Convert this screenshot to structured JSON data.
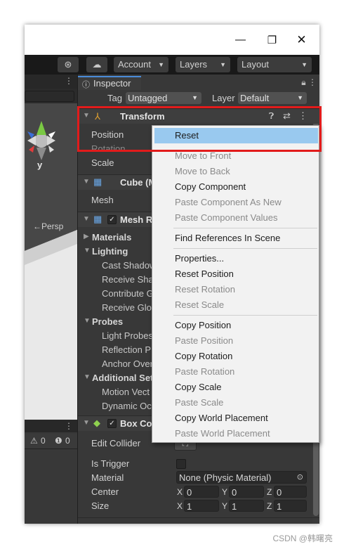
{
  "toolbar": {
    "account_label": "Account",
    "layers_label": "Layers",
    "layout_label": "Layout"
  },
  "scene": {
    "axis_label": "y",
    "persp_label": "←Persp",
    "warning_count": "0",
    "info_count": "0"
  },
  "inspector": {
    "tab_label": "Inspector",
    "tag_label": "Tag",
    "tag_value": "Untagged",
    "layer_label": "Layer",
    "layer_value": "Default",
    "transform": {
      "title": "Transform",
      "position_label": "Position",
      "rotation_label": "Rotation",
      "scale_label": "Scale"
    },
    "cube": {
      "title": "Cube (M",
      "mesh_label": "Mesh"
    },
    "mesh_renderer": {
      "title": "Mesh R",
      "materials_label": "Materials",
      "lighting_label": "Lighting",
      "cast_shadows": "Cast Shadow",
      "receive_shadows": "Receive Sha",
      "contribute_gi": "Contribute G",
      "receive_gi": "Receive Glo",
      "probes_label": "Probes",
      "light_probes": "Light Probes",
      "reflection_probes": "Reflection P",
      "anchor_override": "Anchor Over",
      "additional_settings": "Additional Set",
      "motion_vectors": "Motion Vect",
      "dynamic_occlusion": "Dynamic Oc"
    },
    "box_collider": {
      "title": "Box Col",
      "edit_collider": "Edit Collider",
      "is_trigger": "Is Trigger",
      "material_label": "Material",
      "material_value": "None (Physic Material)",
      "center_label": "Center",
      "size_label": "Size",
      "center": {
        "x": "0",
        "y": "0",
        "z": "0"
      },
      "size": {
        "x": "1",
        "y": "1",
        "z": "1"
      },
      "axis_x": "X",
      "axis_y": "Y",
      "axis_z": "Z"
    }
  },
  "context_menu": {
    "items": [
      {
        "label": "Reset",
        "enabled": true,
        "selected": true
      },
      {
        "label": "Move to Front",
        "enabled": false
      },
      {
        "label": "Move to Back",
        "enabled": false
      },
      {
        "label": "Copy Component",
        "enabled": true
      },
      {
        "label": "Paste Component As New",
        "enabled": false
      },
      {
        "label": "Paste Component Values",
        "enabled": false
      },
      {
        "label": "Find References In Scene",
        "enabled": true
      },
      {
        "label": "Properties...",
        "enabled": true
      },
      {
        "label": "Reset Position",
        "enabled": true
      },
      {
        "label": "Reset Rotation",
        "enabled": false
      },
      {
        "label": "Reset Scale",
        "enabled": false
      },
      {
        "label": "Copy Position",
        "enabled": true
      },
      {
        "label": "Paste Position",
        "enabled": false
      },
      {
        "label": "Copy Rotation",
        "enabled": true
      },
      {
        "label": "Paste Rotation",
        "enabled": false
      },
      {
        "label": "Copy Scale",
        "enabled": true
      },
      {
        "label": "Paste Scale",
        "enabled": false
      },
      {
        "label": "Copy World Placement",
        "enabled": true
      },
      {
        "label": "Paste World Placement",
        "enabled": false
      }
    ]
  },
  "watermark": "CSDN @韩曙亮",
  "colors": {
    "highlight_box": "#e21b1b",
    "selected_item": "#99c9ef",
    "accent_tab": "#4a8bd8"
  }
}
